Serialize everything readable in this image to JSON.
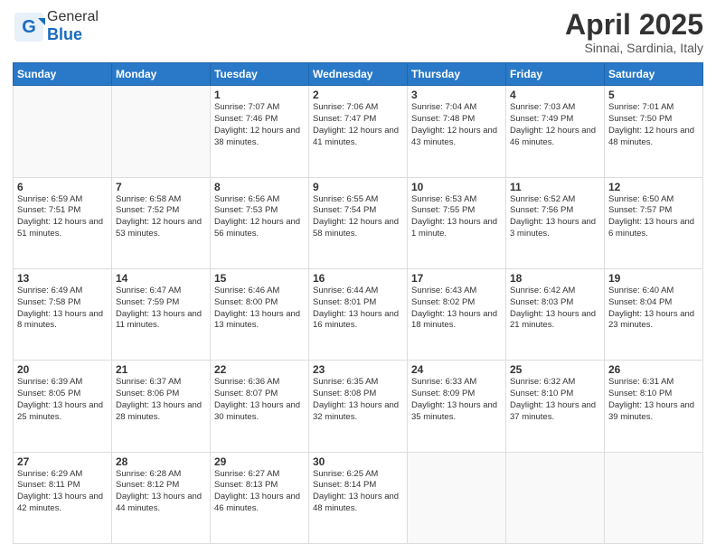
{
  "logo": {
    "general": "General",
    "blue": "Blue"
  },
  "header": {
    "month": "April 2025",
    "location": "Sinnai, Sardinia, Italy"
  },
  "weekdays": [
    "Sunday",
    "Monday",
    "Tuesday",
    "Wednesday",
    "Thursday",
    "Friday",
    "Saturday"
  ],
  "weeks": [
    [
      {
        "day": "",
        "sunrise": "",
        "sunset": "",
        "daylight": ""
      },
      {
        "day": "",
        "sunrise": "",
        "sunset": "",
        "daylight": ""
      },
      {
        "day": "1",
        "sunrise": "Sunrise: 7:07 AM",
        "sunset": "Sunset: 7:46 PM",
        "daylight": "Daylight: 12 hours and 38 minutes."
      },
      {
        "day": "2",
        "sunrise": "Sunrise: 7:06 AM",
        "sunset": "Sunset: 7:47 PM",
        "daylight": "Daylight: 12 hours and 41 minutes."
      },
      {
        "day": "3",
        "sunrise": "Sunrise: 7:04 AM",
        "sunset": "Sunset: 7:48 PM",
        "daylight": "Daylight: 12 hours and 43 minutes."
      },
      {
        "day": "4",
        "sunrise": "Sunrise: 7:03 AM",
        "sunset": "Sunset: 7:49 PM",
        "daylight": "Daylight: 12 hours and 46 minutes."
      },
      {
        "day": "5",
        "sunrise": "Sunrise: 7:01 AM",
        "sunset": "Sunset: 7:50 PM",
        "daylight": "Daylight: 12 hours and 48 minutes."
      }
    ],
    [
      {
        "day": "6",
        "sunrise": "Sunrise: 6:59 AM",
        "sunset": "Sunset: 7:51 PM",
        "daylight": "Daylight: 12 hours and 51 minutes."
      },
      {
        "day": "7",
        "sunrise": "Sunrise: 6:58 AM",
        "sunset": "Sunset: 7:52 PM",
        "daylight": "Daylight: 12 hours and 53 minutes."
      },
      {
        "day": "8",
        "sunrise": "Sunrise: 6:56 AM",
        "sunset": "Sunset: 7:53 PM",
        "daylight": "Daylight: 12 hours and 56 minutes."
      },
      {
        "day": "9",
        "sunrise": "Sunrise: 6:55 AM",
        "sunset": "Sunset: 7:54 PM",
        "daylight": "Daylight: 12 hours and 58 minutes."
      },
      {
        "day": "10",
        "sunrise": "Sunrise: 6:53 AM",
        "sunset": "Sunset: 7:55 PM",
        "daylight": "Daylight: 13 hours and 1 minute."
      },
      {
        "day": "11",
        "sunrise": "Sunrise: 6:52 AM",
        "sunset": "Sunset: 7:56 PM",
        "daylight": "Daylight: 13 hours and 3 minutes."
      },
      {
        "day": "12",
        "sunrise": "Sunrise: 6:50 AM",
        "sunset": "Sunset: 7:57 PM",
        "daylight": "Daylight: 13 hours and 6 minutes."
      }
    ],
    [
      {
        "day": "13",
        "sunrise": "Sunrise: 6:49 AM",
        "sunset": "Sunset: 7:58 PM",
        "daylight": "Daylight: 13 hours and 8 minutes."
      },
      {
        "day": "14",
        "sunrise": "Sunrise: 6:47 AM",
        "sunset": "Sunset: 7:59 PM",
        "daylight": "Daylight: 13 hours and 11 minutes."
      },
      {
        "day": "15",
        "sunrise": "Sunrise: 6:46 AM",
        "sunset": "Sunset: 8:00 PM",
        "daylight": "Daylight: 13 hours and 13 minutes."
      },
      {
        "day": "16",
        "sunrise": "Sunrise: 6:44 AM",
        "sunset": "Sunset: 8:01 PM",
        "daylight": "Daylight: 13 hours and 16 minutes."
      },
      {
        "day": "17",
        "sunrise": "Sunrise: 6:43 AM",
        "sunset": "Sunset: 8:02 PM",
        "daylight": "Daylight: 13 hours and 18 minutes."
      },
      {
        "day": "18",
        "sunrise": "Sunrise: 6:42 AM",
        "sunset": "Sunset: 8:03 PM",
        "daylight": "Daylight: 13 hours and 21 minutes."
      },
      {
        "day": "19",
        "sunrise": "Sunrise: 6:40 AM",
        "sunset": "Sunset: 8:04 PM",
        "daylight": "Daylight: 13 hours and 23 minutes."
      }
    ],
    [
      {
        "day": "20",
        "sunrise": "Sunrise: 6:39 AM",
        "sunset": "Sunset: 8:05 PM",
        "daylight": "Daylight: 13 hours and 25 minutes."
      },
      {
        "day": "21",
        "sunrise": "Sunrise: 6:37 AM",
        "sunset": "Sunset: 8:06 PM",
        "daylight": "Daylight: 13 hours and 28 minutes."
      },
      {
        "day": "22",
        "sunrise": "Sunrise: 6:36 AM",
        "sunset": "Sunset: 8:07 PM",
        "daylight": "Daylight: 13 hours and 30 minutes."
      },
      {
        "day": "23",
        "sunrise": "Sunrise: 6:35 AM",
        "sunset": "Sunset: 8:08 PM",
        "daylight": "Daylight: 13 hours and 32 minutes."
      },
      {
        "day": "24",
        "sunrise": "Sunrise: 6:33 AM",
        "sunset": "Sunset: 8:09 PM",
        "daylight": "Daylight: 13 hours and 35 minutes."
      },
      {
        "day": "25",
        "sunrise": "Sunrise: 6:32 AM",
        "sunset": "Sunset: 8:10 PM",
        "daylight": "Daylight: 13 hours and 37 minutes."
      },
      {
        "day": "26",
        "sunrise": "Sunrise: 6:31 AM",
        "sunset": "Sunset: 8:10 PM",
        "daylight": "Daylight: 13 hours and 39 minutes."
      }
    ],
    [
      {
        "day": "27",
        "sunrise": "Sunrise: 6:29 AM",
        "sunset": "Sunset: 8:11 PM",
        "daylight": "Daylight: 13 hours and 42 minutes."
      },
      {
        "day": "28",
        "sunrise": "Sunrise: 6:28 AM",
        "sunset": "Sunset: 8:12 PM",
        "daylight": "Daylight: 13 hours and 44 minutes."
      },
      {
        "day": "29",
        "sunrise": "Sunrise: 6:27 AM",
        "sunset": "Sunset: 8:13 PM",
        "daylight": "Daylight: 13 hours and 46 minutes."
      },
      {
        "day": "30",
        "sunrise": "Sunrise: 6:25 AM",
        "sunset": "Sunset: 8:14 PM",
        "daylight": "Daylight: 13 hours and 48 minutes."
      },
      {
        "day": "",
        "sunrise": "",
        "sunset": "",
        "daylight": ""
      },
      {
        "day": "",
        "sunrise": "",
        "sunset": "",
        "daylight": ""
      },
      {
        "day": "",
        "sunrise": "",
        "sunset": "",
        "daylight": ""
      }
    ]
  ]
}
